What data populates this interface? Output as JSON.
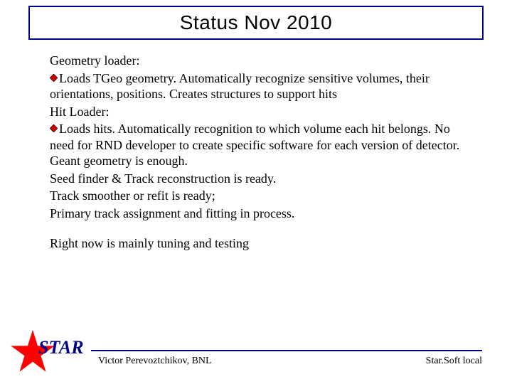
{
  "title": "Status Nov 2010",
  "body": {
    "p1": "Geometry loader:",
    "b1": "Loads TGeo geometry. Automatically recognize sensitive volumes, their orientations, positions. Creates structures to support hits",
    "p2": "Hit Loader:",
    "b2": "Loads hits. Automatically recognition to which volume each hit belongs. No need for RND developer to create specific software for each version of detector. Geant geometry is enough.",
    "p3": "Seed finder & Track reconstruction is ready.",
    "p4": "Track smoother or refit is ready;",
    "p5": "Primary track assignment and fitting in process.",
    "p6": "Right now is mainly tuning and testing"
  },
  "logo": {
    "text": "STAR"
  },
  "footer": {
    "left": "Victor Perevoztchikov, BNL",
    "right": "Star.Soft local"
  },
  "colors": {
    "border": "#00008b",
    "bullet_fill": "#cc0000",
    "bullet_stroke": "#000000",
    "star_fill": "#ff0000"
  }
}
